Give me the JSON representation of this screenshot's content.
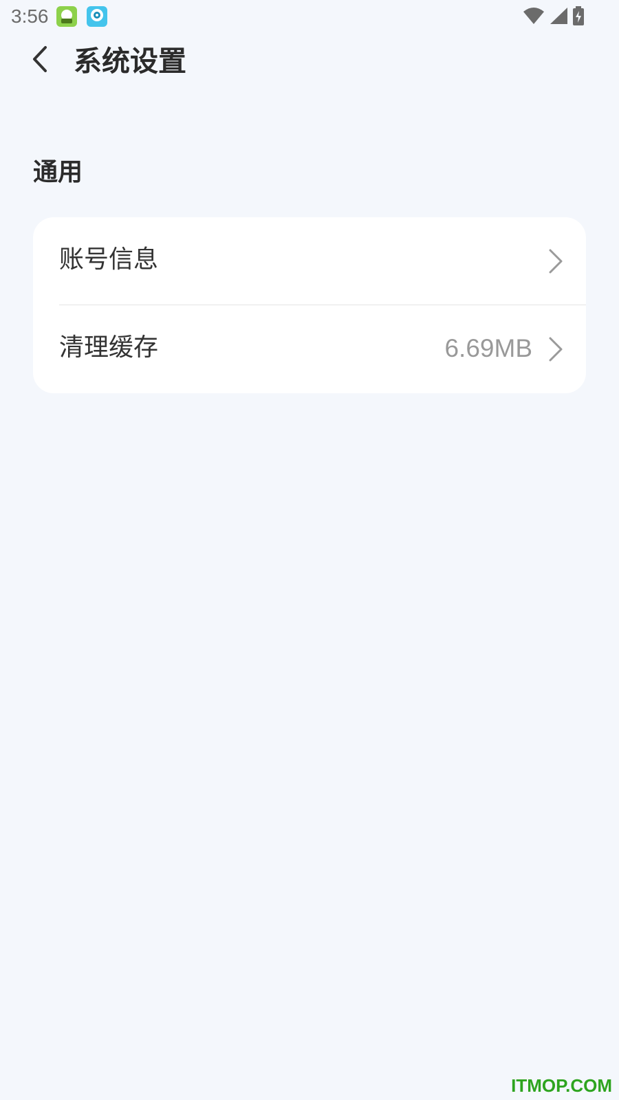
{
  "status_bar": {
    "time": "3:56",
    "icons": [
      "app-notification-icon",
      "app-notification-icon",
      "wifi-icon",
      "signal-icon",
      "battery-charging-icon"
    ]
  },
  "header": {
    "title": "系统设置",
    "back_icon": "chevron-left-icon"
  },
  "section": {
    "title": "通用",
    "items": [
      {
        "label": "账号信息",
        "value": "",
        "icon": "chevron-right-icon"
      },
      {
        "label": "清理缓存",
        "value": "6.69MB",
        "icon": "chevron-right-icon"
      }
    ]
  },
  "watermark": "ITMOP.COM",
  "colors": {
    "background": "#f4f7fc",
    "card": "#ffffff",
    "text_primary": "#333333",
    "text_secondary": "#999999",
    "watermark": "#2ea41f"
  }
}
